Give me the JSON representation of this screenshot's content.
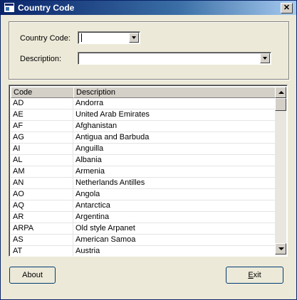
{
  "window": {
    "title": "Country Code",
    "close_glyph": "✕"
  },
  "form": {
    "country_code_label": "Country Code:",
    "country_code_value": "",
    "description_label": "Description:",
    "description_value": ""
  },
  "grid": {
    "columns": [
      "Code",
      "Description"
    ],
    "rows": [
      {
        "code": "AD",
        "description": "Andorra"
      },
      {
        "code": "AE",
        "description": "United Arab Emirates"
      },
      {
        "code": "AF",
        "description": "Afghanistan"
      },
      {
        "code": "AG",
        "description": "Antigua and Barbuda"
      },
      {
        "code": "AI",
        "description": "Anguilla"
      },
      {
        "code": "AL",
        "description": "Albania"
      },
      {
        "code": "AM",
        "description": "Armenia"
      },
      {
        "code": "AN",
        "description": "Netherlands Antilles"
      },
      {
        "code": "AO",
        "description": "Angola"
      },
      {
        "code": "AQ",
        "description": "Antarctica"
      },
      {
        "code": "AR",
        "description": "Argentina"
      },
      {
        "code": "ARPA",
        "description": "Old style Arpanet"
      },
      {
        "code": "AS",
        "description": "American Samoa"
      },
      {
        "code": "AT",
        "description": "Austria"
      }
    ]
  },
  "buttons": {
    "about": "About",
    "exit": "Exit"
  },
  "icons": {
    "app": "app-window-icon",
    "close": "close-icon",
    "dropdown": "chevron-down-icon",
    "scroll_up": "scroll-up-icon",
    "scroll_down": "scroll-down-icon"
  }
}
